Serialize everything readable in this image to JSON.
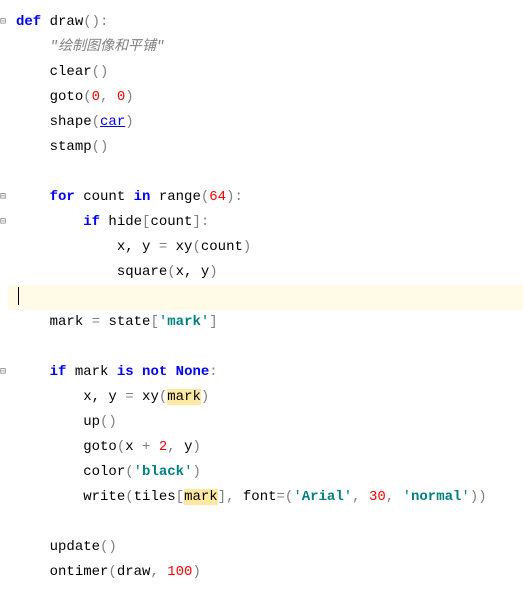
{
  "code": {
    "line1": {
      "def": "def",
      "name": " draw",
      "paren": "():"
    },
    "line2": {
      "docstring": "\"绘制图像和平铺\""
    },
    "line3": {
      "fn": "clear",
      "paren": "()"
    },
    "line4": {
      "fn": "goto",
      "open": "(",
      "arg1": "0",
      "comma": ", ",
      "arg2": "0",
      "close": ")"
    },
    "line5": {
      "fn": "shape",
      "open": "(",
      "arg": "car",
      "close": ")"
    },
    "line6": {
      "fn": "stamp",
      "paren": "()"
    },
    "line8": {
      "for": "for",
      "var": " count ",
      "in": "in",
      "fn": " range",
      "open": "(",
      "num": "64",
      "close": "):"
    },
    "line9": {
      "if": "if",
      "expr": " hide",
      "bracket": "[",
      "idx": "count",
      "close": "]:"
    },
    "line10": {
      "lhs": "x, y ",
      "eq": "= ",
      "fn": "xy",
      "open": "(",
      "arg": "count",
      "close": ")"
    },
    "line11": {
      "fn": "square",
      "open": "(",
      "args": "x, y",
      "close": ")"
    },
    "line13": {
      "lhs": "mark ",
      "eq": "= ",
      "var": "state",
      "open": "[",
      "key": "'",
      "keybold": "mark",
      "keyend": "'",
      "close": "]"
    },
    "line15": {
      "if": "if",
      "var": " mark ",
      "isnot": "is not",
      "none": " None",
      "colon": ":"
    },
    "line16": {
      "lhs": "x, y ",
      "eq": "= ",
      "fn": "xy",
      "open": "(",
      "arg": "mark",
      "close": ")"
    },
    "line17": {
      "fn": "up",
      "paren": "()"
    },
    "line18": {
      "fn": "goto",
      "open": "(",
      "arg1": "x ",
      "plus": "+ ",
      "num": "2",
      "comma": ", ",
      "arg2": "y",
      "close": ")"
    },
    "line19": {
      "fn": "color",
      "open": "(",
      "q1": "'",
      "val": "black",
      "q2": "'",
      "close": ")"
    },
    "line20": {
      "fn": "write",
      "open": "(",
      "var": "tiles",
      "bopen": "[",
      "idx": "mark",
      "bclose": "], ",
      "fontlbl": "font",
      "eq": "=(",
      "q1": "'",
      "font": "Arial",
      "q2": "'",
      "c1": ", ",
      "size": "30",
      "c2": ", ",
      "q3": "'",
      "style": "normal",
      "q4": "'",
      "close": "))"
    },
    "line22": {
      "fn": "update",
      "paren": "()"
    },
    "line23": {
      "fn": "ontimer",
      "open": "(",
      "arg1": "draw",
      "comma": ", ",
      "num": "100",
      "close": ")"
    }
  }
}
